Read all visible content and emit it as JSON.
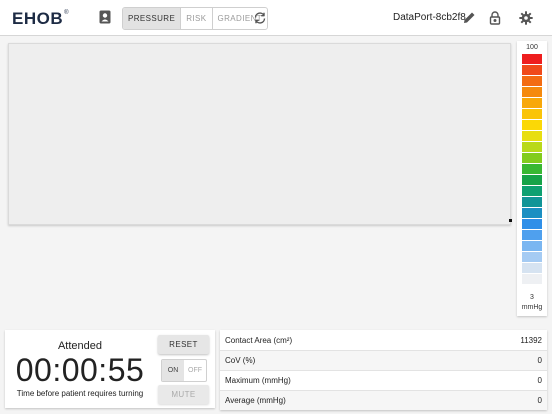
{
  "header": {
    "logo_text": "EHOB",
    "logo_mark": "®",
    "tabs": [
      {
        "label": "PRESSURE",
        "active": true
      },
      {
        "label": "RISK",
        "active": false
      },
      {
        "label": "GRADIENT",
        "active": false
      }
    ],
    "device_name": "DataPort-8cb2f8",
    "icons": [
      "contact-badge-icon",
      "refresh-icon",
      "pencil-icon",
      "lock-icon",
      "gear-icon"
    ]
  },
  "scale": {
    "max_label": "100",
    "min_label": "3",
    "unit_label": "mmHg",
    "colors": [
      "#ee1e1e",
      "#f04a1a",
      "#f36c13",
      "#f58a0e",
      "#f8a80a",
      "#fac408",
      "#fbd806",
      "#e8de10",
      "#b9d91a",
      "#82cc1c",
      "#38b832",
      "#16a348",
      "#0ea071",
      "#119597",
      "#1b8fc2",
      "#2f8fe8",
      "#4fa0ee",
      "#7ab6f1",
      "#a5cbf3",
      "#d6e3f1",
      "#eef0f3"
    ]
  },
  "timer": {
    "status": "Attended",
    "time": "00:00:55",
    "caption": "Time before patient requires turning",
    "reset_label": "RESET",
    "toggle_on": "ON",
    "toggle_off": "OFF",
    "toggle_state": "on",
    "mute_label": "MUTE"
  },
  "stats": [
    {
      "label": "Contact Area (cm²)",
      "value": "11392"
    },
    {
      "label": "CoV (%)",
      "value": "0"
    },
    {
      "label": "Maximum (mmHg)",
      "value": "0"
    },
    {
      "label": "Average (mmHg)",
      "value": "0"
    }
  ]
}
